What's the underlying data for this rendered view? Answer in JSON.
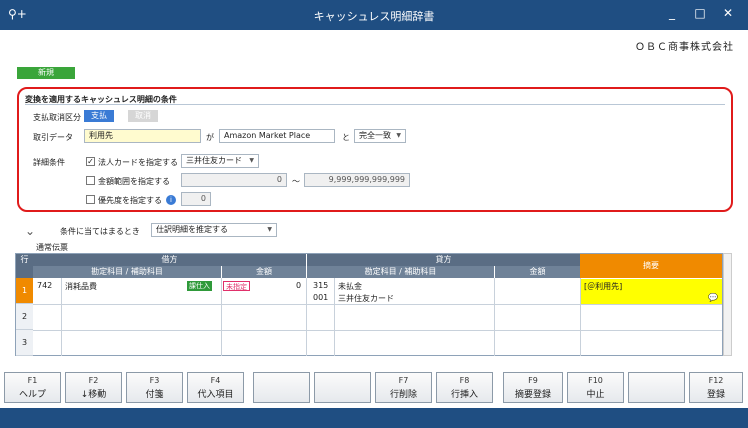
{
  "window": {
    "title": "キャッシュレス明細辞書",
    "icon": "search-plus-icon",
    "min": "_",
    "max": "□",
    "close": "✕"
  },
  "company": "ＯＢＣ商事株式会社",
  "status_badge": "新規",
  "conditions": {
    "title": "変換を適用するキャッシュレス明細の条件",
    "payment_label": "支払取消区分",
    "payment_options": [
      "支払",
      "取消"
    ],
    "payment_selected": "支払",
    "data_label": "取引データ",
    "data_field": "利用先",
    "ga": "が",
    "data_value": "Amazon Market Place",
    "to": "と",
    "match": "完全一致",
    "detail_label": "詳細条件",
    "corp_card_label": "法人カードを指定する",
    "corp_card_checked": "✓",
    "corp_card_value": "三井住友カード",
    "amount_label": "金額範囲を指定する",
    "amount_from": "0",
    "tilde": "〜",
    "amount_to": "9,999,999,999,999",
    "priority_label": "優先度を指定する",
    "priority_info": "i",
    "priority_value": "0"
  },
  "rule": {
    "label": "条件に当てはまるとき",
    "value": "仕訳明細を推定する"
  },
  "grid": {
    "tab": "通常伝票",
    "headers": {
      "row": "行",
      "debit": "借方",
      "credit": "貸方",
      "account": "勘定科目 / 補助科目",
      "amount": "金額",
      "summary": "摘要"
    },
    "rows": [
      {
        "num": "1",
        "d_code": "742",
        "d_name": "消耗品費",
        "d_tag1": "課仕入",
        "d_tag2": "未指定",
        "d_amount": "0",
        "c_code": "315",
        "c_name": "未払金",
        "c_sub_code": "001",
        "c_sub_name": "三井住友カード",
        "c_amount": "",
        "summary": "[＠利用先]"
      },
      {
        "num": "2"
      },
      {
        "num": "3"
      }
    ]
  },
  "fkeys": [
    {
      "key": "F1",
      "label": "ヘルプ"
    },
    {
      "key": "F2",
      "label": "↓移動"
    },
    {
      "key": "F3",
      "label": "付箋"
    },
    {
      "key": "F4",
      "label": "代入項目"
    },
    {
      "key": "",
      "label": ""
    },
    {
      "key": "",
      "label": ""
    },
    {
      "key": "F7",
      "label": "行削除"
    },
    {
      "key": "F8",
      "label": "行挿入"
    },
    {
      "key": "F9",
      "label": "摘要登録"
    },
    {
      "key": "F10",
      "label": "中止"
    },
    {
      "key": "",
      "label": ""
    },
    {
      "key": "F12",
      "label": "登録"
    }
  ],
  "colors": {
    "title_bar": "#1f4e82",
    "accent": "#3a7bd5",
    "highlight_border": "#e01b1b",
    "summary_header": "#f08a00",
    "summary_cell": "#ffff00"
  }
}
